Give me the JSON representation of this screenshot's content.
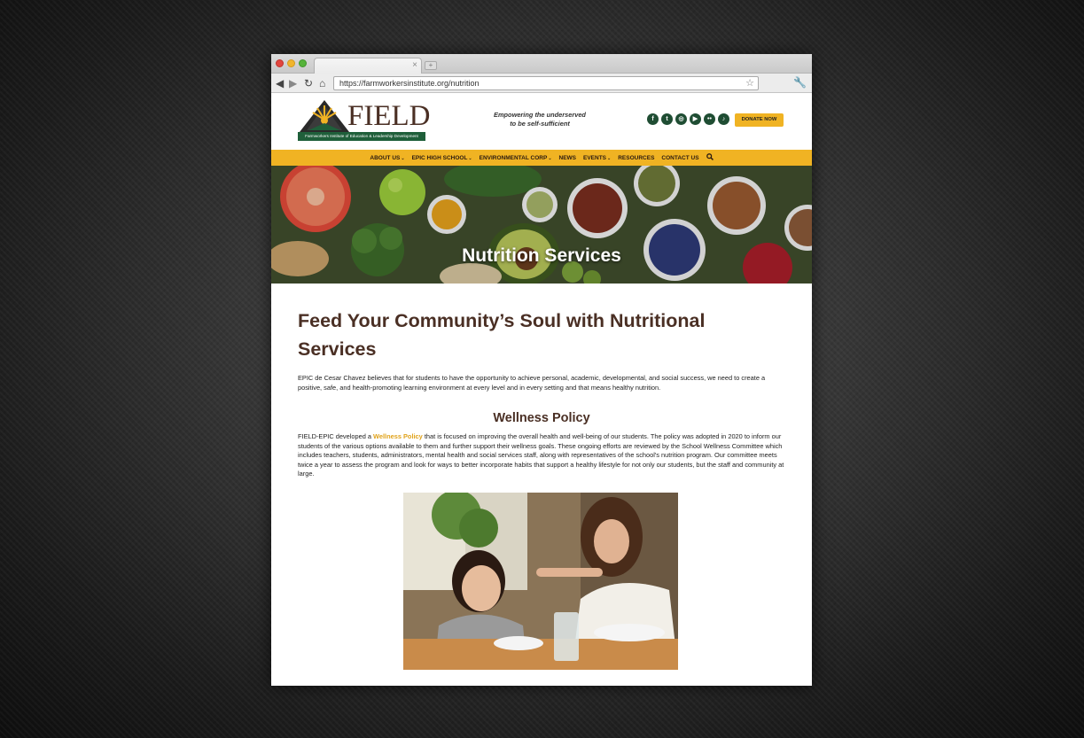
{
  "browser": {
    "url": "https://farmworkersinstitute.org/nutrition",
    "tab_close": "×",
    "new_tab": "+",
    "back_icon": "◀",
    "forward_icon": "▶",
    "reload_icon": "↻",
    "home_icon": "⌂",
    "star_icon": "☆",
    "wrench_icon": "🔧"
  },
  "header": {
    "logo_text": "FIELD",
    "logo_subtext": "Farmworkers Institute of Education & Leadership Development",
    "tagline_line1": "Empowering the underserved",
    "tagline_line2": "to be self-sufficient",
    "social": [
      {
        "name": "facebook-icon",
        "glyph": "f"
      },
      {
        "name": "twitter-icon",
        "glyph": "t"
      },
      {
        "name": "instagram-icon",
        "glyph": "◎"
      },
      {
        "name": "youtube-icon",
        "glyph": "▶"
      },
      {
        "name": "flickr-icon",
        "glyph": "••"
      },
      {
        "name": "tiktok-icon",
        "glyph": "♪"
      }
    ],
    "donate_label": "DONATE NOW"
  },
  "nav": {
    "items": [
      {
        "label": "ABOUT US",
        "dropdown": true
      },
      {
        "label": "EPIC HIGH SCHOOL",
        "dropdown": true
      },
      {
        "label": "ENVIRONMENTAL CORP",
        "dropdown": true
      },
      {
        "label": "NEWS",
        "dropdown": false
      },
      {
        "label": "EVENTS",
        "dropdown": true
      },
      {
        "label": "RESOURCES",
        "dropdown": false
      },
      {
        "label": "CONTACT US",
        "dropdown": false
      }
    ],
    "search_icon": "🔍"
  },
  "hero": {
    "title": "Nutrition Services"
  },
  "main": {
    "heading": "Feed Your Community’s Soul with Nutritional Services",
    "intro": "EPIC de Cesar Chavez believes that for students to have the opportunity to achieve personal, academic, developmental, and social success, we need to create a positive, safe, and health-promoting learning environment at every level and in every setting and that means healthy nutrition.",
    "wellness_heading": "Wellness Policy",
    "policy_before": "FIELD-EPIC developed a ",
    "policy_link": "Wellness Policy",
    "policy_after": " that is focused on improving the overall health and well-being of our students. The policy was adopted in 2020 to inform our students of the various options available to them and further support their wellness goals. These ongoing efforts are reviewed by the School Wellness Committee which includes teachers, students, administrators, mental health and social services staff, along with representatives of the school's nutrition program. Our committee meets twice a year to assess the program and look for ways to better incorporate habits that support a healthy lifestyle for not only our students, but the staff and community at large."
  },
  "colors": {
    "accent": "#f0b323",
    "brand_brown": "#4a2f24",
    "brand_green": "#1f5f3a"
  }
}
